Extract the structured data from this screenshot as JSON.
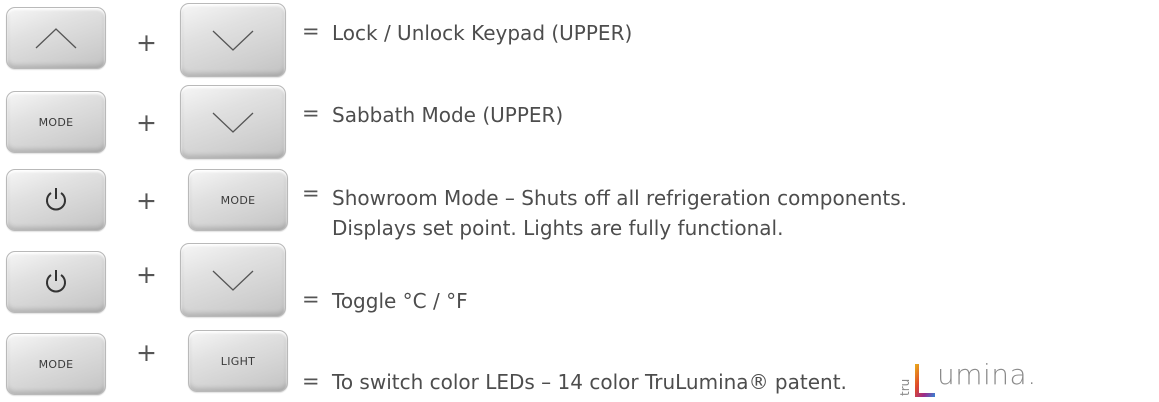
{
  "keys": {
    "mode": "MODE",
    "light": "LIGHT"
  },
  "operators": {
    "plus": "+",
    "equals": "="
  },
  "rows": [
    {
      "left_key": "up-arrow",
      "right_key": "down-arrow",
      "description": "Lock / Unlock Keypad (UPPER)"
    },
    {
      "left_key": "MODE",
      "right_key": "down-arrow",
      "description": "Sabbath Mode (UPPER)"
    },
    {
      "left_key": "power",
      "right_key": "MODE",
      "description": "Showroom Mode – Shuts off all refrigeration components.",
      "description_line2": "Displays set point. Lights are fully functional."
    },
    {
      "left_key": "power",
      "right_key": "down-arrow",
      "description": "Toggle °C / °F"
    },
    {
      "left_key": "MODE",
      "right_key": "LIGHT",
      "description": "To switch color LEDs – 14 color TruLumina® patent."
    }
  ],
  "logo": {
    "tru_text": "tru",
    "wordmark_rest": "umina.",
    "l_gradient": [
      "#e8a21c",
      "#e04a2a",
      "#9b2b8c",
      "#3b7fd0"
    ]
  }
}
